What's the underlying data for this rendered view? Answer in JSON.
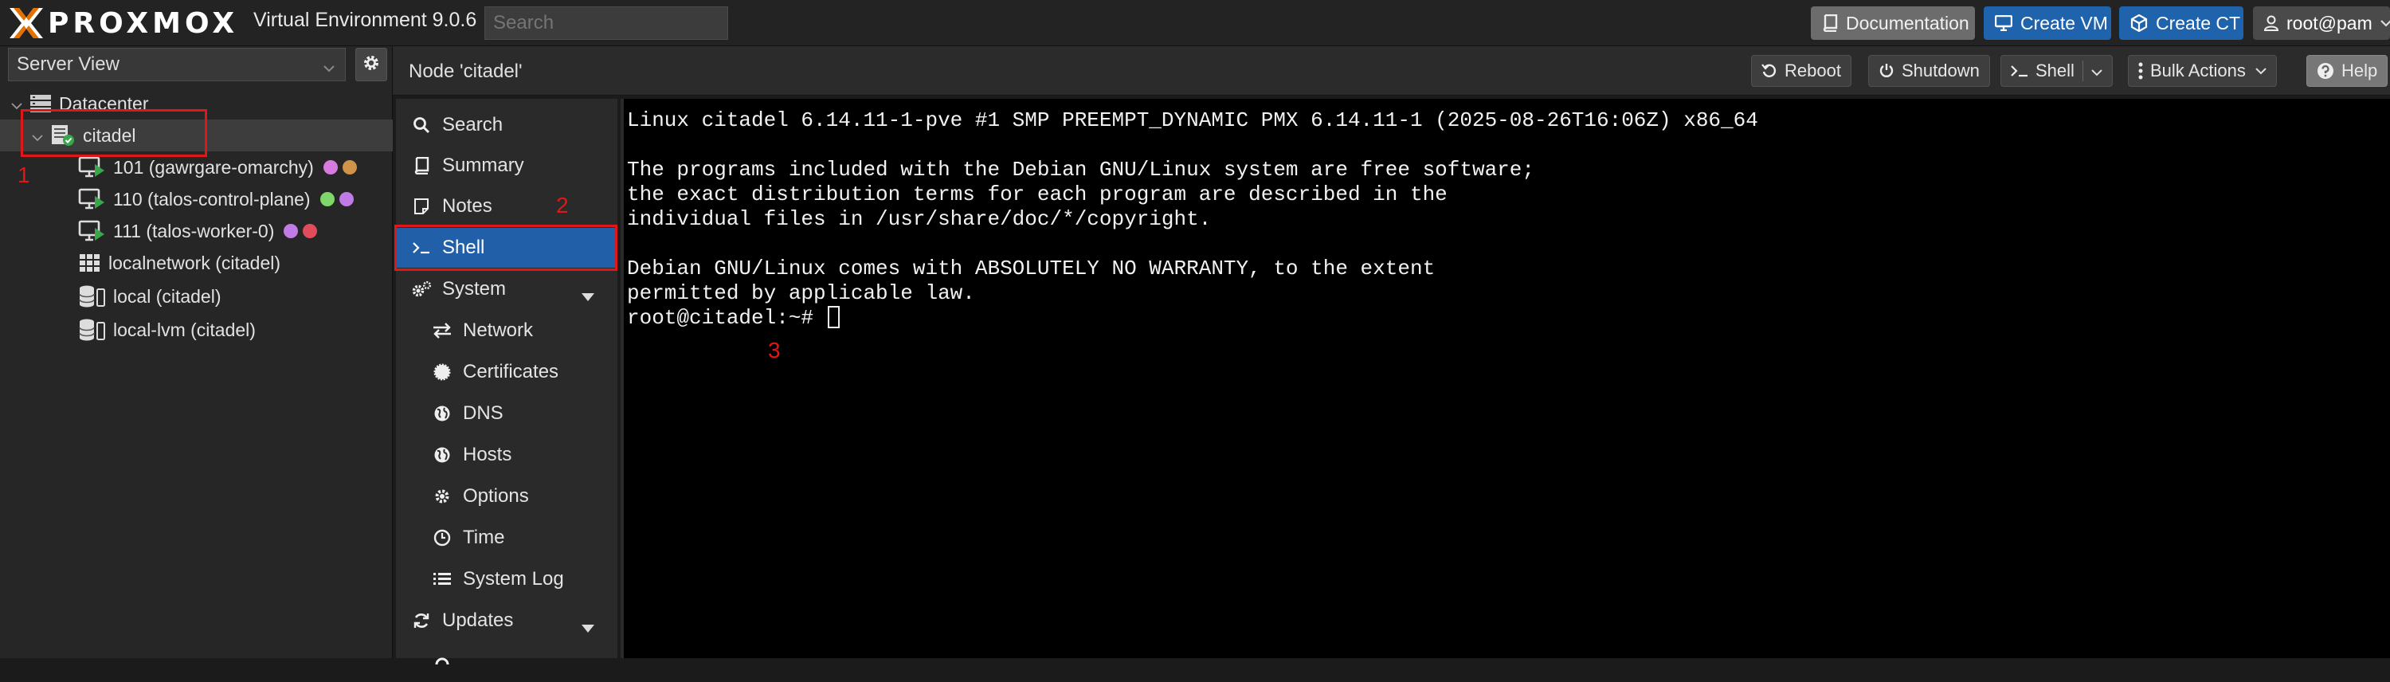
{
  "header": {
    "logo_text": "PROXMOX",
    "app_title": "Virtual Environment 9.0.6",
    "search_placeholder": "Search",
    "documentation_label": "Documentation",
    "create_vm_label": "Create VM",
    "create_ct_label": "Create CT",
    "user_label": "root@pam"
  },
  "tree": {
    "view_label": "Server View",
    "datacenter_label": "Datacenter",
    "node_label": "citadel",
    "guests": [
      {
        "label": "101 (gawrgare-omarchy)",
        "tag_colors": [
          "#d77be0",
          "#d0934a"
        ]
      },
      {
        "label": "110 (talos-control-plane)",
        "tag_colors": [
          "#7fd66a",
          "#c17be6"
        ]
      },
      {
        "label": "111 (talos-worker-0)",
        "tag_colors": [
          "#c17be6",
          "#e04c5c"
        ]
      }
    ],
    "network_label": "localnetwork (citadel)",
    "storage": [
      {
        "label": "local (citadel)"
      },
      {
        "label": "local-lvm (citadel)"
      }
    ]
  },
  "content": {
    "title": "Node 'citadel'",
    "reboot_label": "Reboot",
    "shutdown_label": "Shutdown",
    "shell_label": "Shell",
    "bulk_actions_label": "Bulk Actions",
    "help_label": "Help"
  },
  "menu": {
    "search": "Search",
    "summary": "Summary",
    "notes": "Notes",
    "shell": "Shell",
    "system": "System",
    "network": "Network",
    "certificates": "Certificates",
    "dns": "DNS",
    "hosts": "Hosts",
    "options": "Options",
    "time": "Time",
    "system_log": "System Log",
    "updates": "Updates"
  },
  "terminal": {
    "lines": [
      "Linux citadel 6.14.11-1-pve #1 SMP PREEMPT_DYNAMIC PMX 6.14.11-1 (2025-08-26T16:06Z) x86_64",
      "",
      "The programs included with the Debian GNU/Linux system are free software;",
      "the exact distribution terms for each program are described in the",
      "individual files in /usr/share/doc/*/copyright.",
      "",
      "Debian GNU/Linux comes with ABSOLUTELY NO WARRANTY, to the extent",
      "permitted by applicable law."
    ],
    "prompt": "root@citadel:~# "
  },
  "annotations": {
    "n1": "1",
    "n2": "2",
    "n3": "3",
    "color": "#e01717"
  },
  "colors": {
    "accent": "#2160a8",
    "header_bg": "#232323",
    "logo_orange": "#e57000"
  }
}
